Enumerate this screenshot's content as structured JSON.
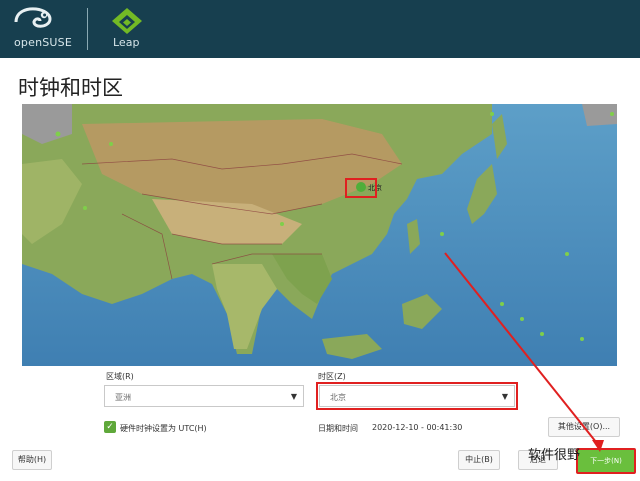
{
  "header": {
    "brand_left": "openSUSE",
    "brand_right": "Leap",
    "colors": {
      "bar": "#173f4f",
      "leap_green": "#73ba25"
    }
  },
  "page": {
    "title": "时钟和时区"
  },
  "map": {
    "selected_city_label": "北京"
  },
  "form": {
    "region_label": "区域(R)",
    "region_value": "亚洲",
    "timezone_label": "时区(Z)",
    "timezone_value": "北京",
    "utc_checkbox_label": "硬件时钟设置为 UTC(H)",
    "utc_checked": true,
    "datetime_label": "日期和时间",
    "datetime_value": "2020-12-10 - 00:41:30",
    "other_settings_button": "其他设置(O)..."
  },
  "footer": {
    "help_button": "帮助(H)",
    "back_button": "中止(B)",
    "abort_button": "后退",
    "next_button": "下一步(N)"
  },
  "watermark": "软件很野"
}
